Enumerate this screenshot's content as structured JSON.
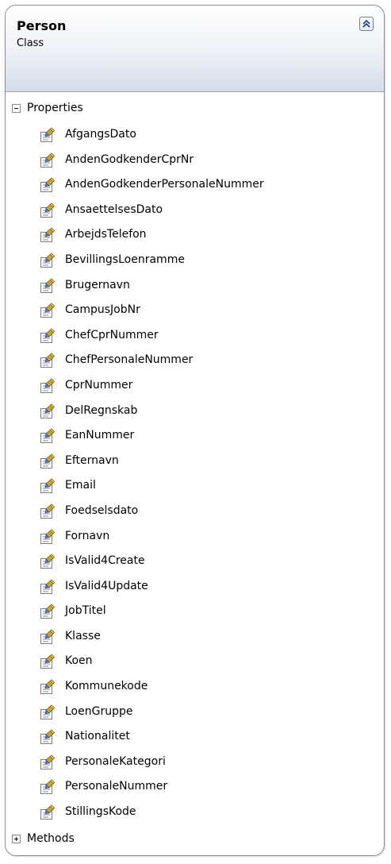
{
  "class": {
    "name": "Person",
    "stereotype": "Class",
    "collapse_icon": "double-chevron-up-icon"
  },
  "properties_section": {
    "label": "Properties",
    "state": "expanded",
    "toggle_icon": "minus-box-icon",
    "item_icon": "property-icon",
    "items": [
      "AfgangsDato",
      "AndenGodkenderCprNr",
      "AndenGodkenderPersonaleNummer",
      "AnsaettelsesDato",
      "ArbejdsTelefon",
      "BevillingsLoenramme",
      "Brugernavn",
      "CampusJobNr",
      "ChefCprNummer",
      "ChefPersonaleNummer",
      "CprNummer",
      "DelRegnskab",
      "EanNummer",
      "Efternavn",
      "Email",
      "Foedselsdato",
      "Fornavn",
      "IsValid4Create",
      "IsValid4Update",
      "JobTitel",
      "Klasse",
      "Koen",
      "Kommunekode",
      "LoenGruppe",
      "Nationalitet",
      "PersonaleKategori",
      "PersonaleNummer",
      "StillingsKode"
    ]
  },
  "methods_section": {
    "label": "Methods",
    "state": "collapsed",
    "toggle_icon": "plus-box-icon"
  },
  "colors": {
    "header_gradient_end": "#d5dce9",
    "border": "#8c8c8c"
  }
}
